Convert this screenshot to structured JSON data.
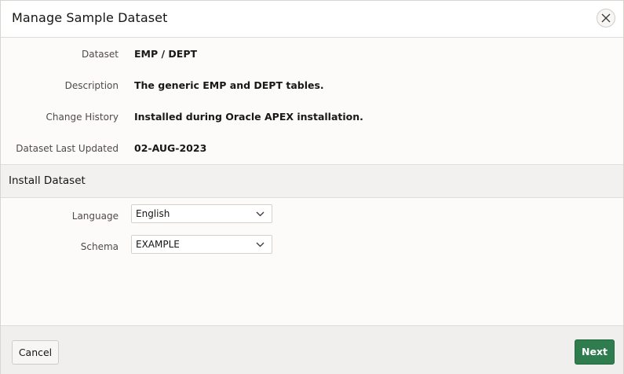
{
  "dialog": {
    "title": "Manage Sample Dataset",
    "close_icon": "close-icon"
  },
  "details": [
    {
      "label": "Dataset",
      "value": "EMP / DEPT"
    },
    {
      "label": "Description",
      "value": "The generic EMP and DEPT tables."
    },
    {
      "label": "Change History",
      "value": "Installed during Oracle APEX installation."
    },
    {
      "label": "Dataset Last Updated",
      "value": "02-AUG-2023"
    }
  ],
  "install_region": {
    "title": "Install Dataset",
    "language": {
      "label": "Language",
      "value": "English"
    },
    "schema": {
      "label": "Schema",
      "value": "EXAMPLE"
    }
  },
  "footer": {
    "cancel_label": "Cancel",
    "next_label": "Next"
  },
  "colors": {
    "primary_button": "#2f7c4f",
    "region_header": "#f2f1ef",
    "footer": "#f1efed"
  }
}
